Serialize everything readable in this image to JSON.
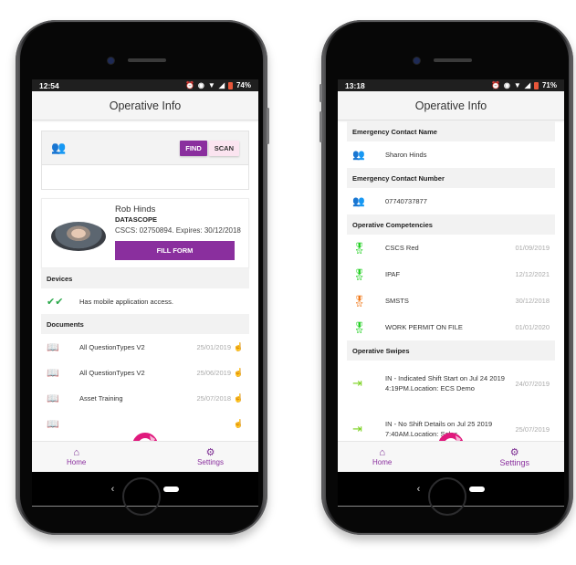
{
  "left_phone": {
    "status": {
      "time": "12:54",
      "battery": "74%"
    },
    "appbar_title": "Operative Info",
    "search": {
      "find_label": "FIND",
      "scan_label": "SCAN",
      "icon": "people-icon",
      "input_value": ""
    },
    "profile": {
      "name": "Rob Hinds",
      "company": "DATASCOPE",
      "cscs": "CSCS: 02750894. Expires: 30/12/2018",
      "fill_form_label": "FILL FORM"
    },
    "devices": {
      "header": "Devices",
      "items": [
        {
          "icon": "double-check-icon",
          "label": "Has mobile application access."
        }
      ]
    },
    "documents": {
      "header": "Documents",
      "items": [
        {
          "label": "All QuestionTypes V2",
          "date": "25/01/2019"
        },
        {
          "label": "All QuestionTypes V2",
          "date": "25/06/2019"
        },
        {
          "label": "Asset Training",
          "date": "25/07/2018"
        },
        {
          "label": "",
          "date": ""
        }
      ]
    },
    "nav": {
      "home_label": "Home",
      "settings_label": "Settings"
    },
    "android_nav": {
      "back": "‹"
    }
  },
  "right_phone": {
    "status": {
      "time": "13:18",
      "battery": "71%"
    },
    "appbar_title": "Operative Info",
    "emergency_name": {
      "header": "Emergency Contact Name",
      "value": "Sharon Hinds"
    },
    "emergency_number": {
      "header": "Emergency Contact Number",
      "value": "07740737877"
    },
    "competencies": {
      "header": "Operative Competencies",
      "items": [
        {
          "label": "CSCS Red",
          "date": "01/09/2019",
          "status_color": "#22d022"
        },
        {
          "label": "IPAF",
          "date": "12/12/2021",
          "status_color": "#22d022"
        },
        {
          "label": "SMSTS",
          "date": "30/12/2018",
          "status_color": "#f07a1c"
        },
        {
          "label": "WORK PERMIT ON FILE",
          "date": "01/01/2020",
          "status_color": "#22d022"
        }
      ]
    },
    "swipes": {
      "header": "Operative Swipes",
      "items": [
        {
          "label": "IN - Indicated Shift Start on Jul 24 2019 4:19PM.Location: ECS Demo",
          "date": "24/07/2019"
        },
        {
          "label": "IN - No Shift Details on Jul 25 2019 7:40AM.Location: Sales",
          "date": "25/07/2019"
        }
      ]
    },
    "nav": {
      "home_label": "Home",
      "settings_label": "Settings"
    },
    "android_nav": {
      "back": "‹"
    }
  },
  "colors": {
    "brand_purple": "#8a2f9e",
    "logo_pink": "#e0197d",
    "scan_bg": "#fbe4f0"
  }
}
